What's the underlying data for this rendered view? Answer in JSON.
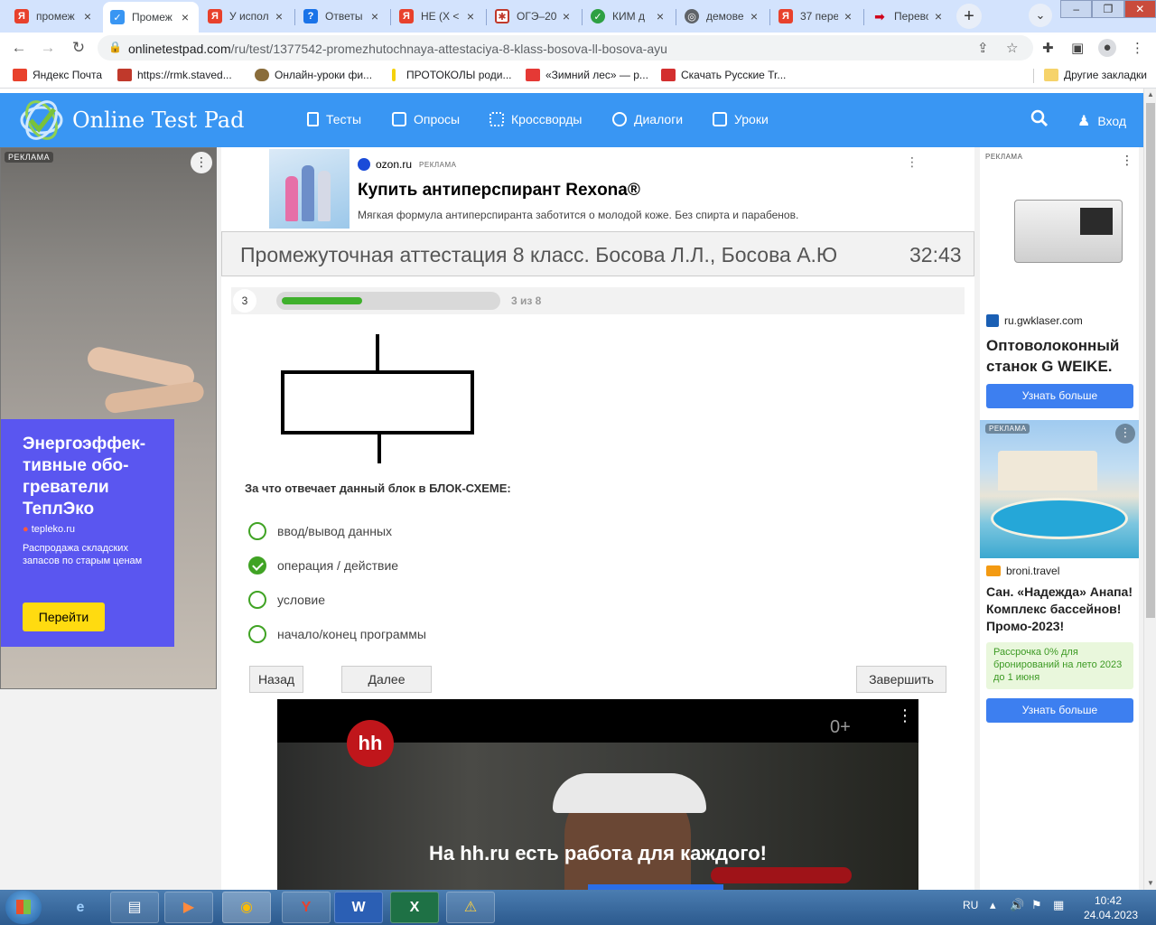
{
  "browser": {
    "tabs": [
      {
        "label": "промеж",
        "icon": "yandex-icon",
        "active": false
      },
      {
        "label": "Промеж",
        "icon": "onlinetestpad-icon",
        "active": true
      },
      {
        "label": "У испол",
        "icon": "yandex-icon",
        "active": false
      },
      {
        "label": "Ответы",
        "icon": "question-icon",
        "active": false
      },
      {
        "label": "НЕ (X <",
        "icon": "yandex-icon",
        "active": false
      },
      {
        "label": "ОГЭ–20",
        "icon": "oge-icon",
        "active": false
      },
      {
        "label": "КИМ д",
        "icon": "check-icon",
        "active": false
      },
      {
        "label": "демове",
        "icon": "globe-icon",
        "active": false
      },
      {
        "label": "37 пере",
        "icon": "yandex-icon",
        "active": false
      },
      {
        "label": "Перево",
        "icon": "arrow-icon",
        "active": false
      }
    ],
    "new_tab": "+",
    "address": {
      "host": "onlinetestpad.com",
      "path": "/ru/test/1377542-promezhutochnaya-attestaciya-8-klass-bosova-ll-bosova-ayu"
    },
    "bookmarks": [
      {
        "label": "Яндекс Почта",
        "color": "#e8412c"
      },
      {
        "label": "https://rmk.staved...",
        "color": "#c0392b"
      },
      {
        "label": "Онлайн-уроки фи...",
        "color": "#8a6d3b"
      },
      {
        "label": "ПРОТОКОЛЫ роди...",
        "color": "#f5d10c"
      },
      {
        "label": "«Зимний лес» — р...",
        "color": "#e53935"
      },
      {
        "label": "Скачать Русские Tr...",
        "color": "#d32f2f"
      }
    ],
    "other_bookmarks": "Другие закладки"
  },
  "site": {
    "logo": "Online Test Pad",
    "nav": [
      "Тесты",
      "Опросы",
      "Кроссворды",
      "Диалоги",
      "Уроки"
    ],
    "login": "Вход",
    "brand_color": "#3996f3"
  },
  "left_ad": {
    "badge": "РЕКЛАМА",
    "title": "Энергоэффек-тивные обо-греватели ТеплЭко",
    "domain": "tepleko.ru",
    "description": "Распродажа складских запасов по старым ценам",
    "button": "Перейти"
  },
  "top_ad": {
    "domain": "ozon.ru",
    "badge": "РЕКЛАМА",
    "title": "Купить антиперспирант Rexona®",
    "description": "Мягкая формула антиперспиранта заботится о молодой коже. Без спирта и парабенов."
  },
  "test": {
    "title": "Промежуточная аттестация 8 класс. Босова Л.Л., Босова А.Ю",
    "timer": "32:43",
    "question_number": "3",
    "progress_text": "3 из 8",
    "progress_fraction": 0.375,
    "question": "За что отвечает данный блок в БЛОК-СХЕМЕ:",
    "answers": [
      {
        "label": "ввод/вывод данных",
        "checked": false
      },
      {
        "label": "операция / действие",
        "checked": true
      },
      {
        "label": "условие",
        "checked": false
      },
      {
        "label": "начало/конец программы",
        "checked": false
      }
    ],
    "buttons": {
      "back": "Назад",
      "next": "Далее",
      "finish": "Завершить"
    },
    "accent_color": "#40a324"
  },
  "video_ad": {
    "logo": "hh",
    "age": "0+",
    "slogan": "На hh.ru есть работа для каждого!"
  },
  "right_ad_1": {
    "badge": "РЕКЛАМА",
    "domain": "ru.gwklaser.com",
    "title": "Оптоволоконный станок G WEIKE.",
    "button": "Узнать больше"
  },
  "right_ad_2": {
    "badge": "РЕКЛАМА",
    "domain": "broni.travel",
    "title": "Сан. «Надежда» Анапа! Комплекс бассейнов! Промо-2023!",
    "promo": "Рассрочка 0% для бронирований на лето 2023 до 1 июня",
    "button": "Узнать больше"
  },
  "taskbar": {
    "apps": [
      "ie-icon",
      "explorer-icon",
      "media-icon",
      "chrome-icon",
      "yandex-browser-icon",
      "word-icon",
      "excel-icon",
      "warning-icon"
    ],
    "lang": "RU",
    "time": "10:42",
    "date": "24.04.2023"
  }
}
